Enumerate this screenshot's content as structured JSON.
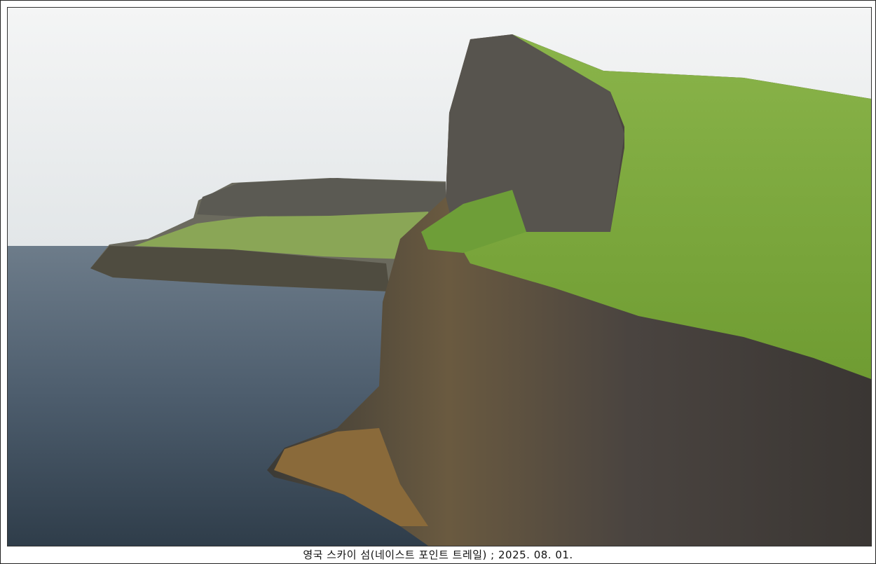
{
  "photo": {
    "subject": "coastal-cliffs-photo",
    "colors": {
      "sky": "#eef0f0",
      "sea": "#4a5a6a",
      "grass": "#7fae3c",
      "rock": "#4a4640"
    }
  },
  "caption": "영국 스카이 섬(네이스트 포인트 트레일) ; 2025. 08. 01."
}
